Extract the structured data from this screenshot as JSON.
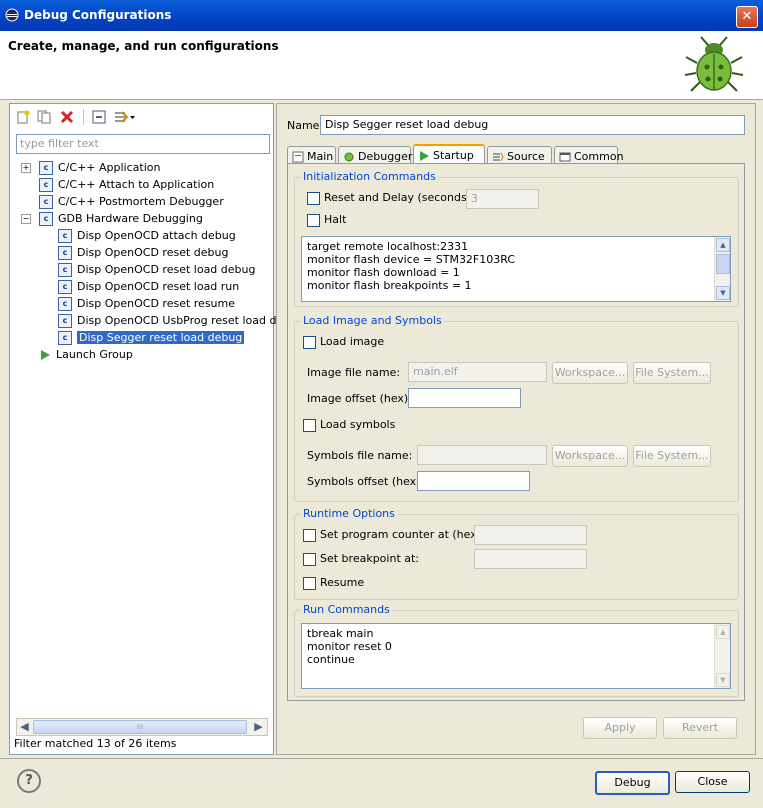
{
  "window": {
    "title": "Debug Configurations"
  },
  "header": {
    "title": "Create, manage, and run configurations"
  },
  "left": {
    "filter_placeholder": "type filter text",
    "tree": [
      {
        "label": "C/C++ Application",
        "level": 0,
        "expander": "+"
      },
      {
        "label": "C/C++ Attach to Application",
        "level": 0
      },
      {
        "label": "C/C++ Postmortem Debugger",
        "level": 0
      },
      {
        "label": "GDB Hardware Debugging",
        "level": 0,
        "expander": "−"
      },
      {
        "label": "Disp OpenOCD attach debug",
        "level": 1
      },
      {
        "label": "Disp OpenOCD reset debug",
        "level": 1
      },
      {
        "label": "Disp OpenOCD reset load debug",
        "level": 1
      },
      {
        "label": "Disp OpenOCD reset load run",
        "level": 1
      },
      {
        "label": "Disp OpenOCD reset resume",
        "level": 1
      },
      {
        "label": "Disp OpenOCD UsbProg reset load debu",
        "level": 1
      },
      {
        "label": "Disp Segger reset load debug",
        "level": 1,
        "selected": true
      },
      {
        "label": "Launch Group",
        "level": 0,
        "icon": "launch-group-icon"
      }
    ],
    "scroll_grip": "III",
    "status": "Filter matched 13 of 26 items"
  },
  "right": {
    "name_label": "Name:",
    "name_value": "Disp Segger reset load debug",
    "tabs": [
      {
        "label": "Main",
        "icon": "main-tab-icon"
      },
      {
        "label": "Debugger",
        "icon": "debugger-tab-icon"
      },
      {
        "label": "Startup",
        "icon": "startup-tab-icon",
        "active": true
      },
      {
        "label": "Source",
        "icon": "source-tab-icon"
      },
      {
        "label": "Common",
        "icon": "common-tab-icon"
      }
    ],
    "init": {
      "title": "Initialization Commands",
      "reset_delay_label": "Reset and Delay (seconds):",
      "reset_delay_value": "3",
      "halt_label": "Halt",
      "commands": [
        "target remote localhost:2331",
        "monitor flash device = STM32F103RC",
        "monitor flash download = 1",
        "monitor flash breakpoints = 1"
      ]
    },
    "load": {
      "title": "Load Image and Symbols",
      "load_image_label": "Load image",
      "image_file_label": "Image file name:",
      "image_file_value": "main.elf",
      "workspace_label": "Workspace...",
      "filesystem_label": "File System...",
      "image_offset_label": "Image offset (hex):",
      "load_symbols_label": "Load symbols",
      "symbols_file_label": "Symbols file name:",
      "symbols_offset_label": "Symbols offset (hex):"
    },
    "runtime": {
      "title": "Runtime Options",
      "pc_label": "Set program counter at (hex):",
      "bp_label": "Set breakpoint at:",
      "resume_label": "Resume"
    },
    "run": {
      "title": "Run Commands",
      "commands": [
        "tbreak main",
        "monitor reset 0",
        "continue"
      ]
    },
    "apply_label": "Apply",
    "revert_label": "Revert"
  },
  "footer": {
    "help_label": "?",
    "debug_label": "Debug",
    "close_label": "Close"
  }
}
